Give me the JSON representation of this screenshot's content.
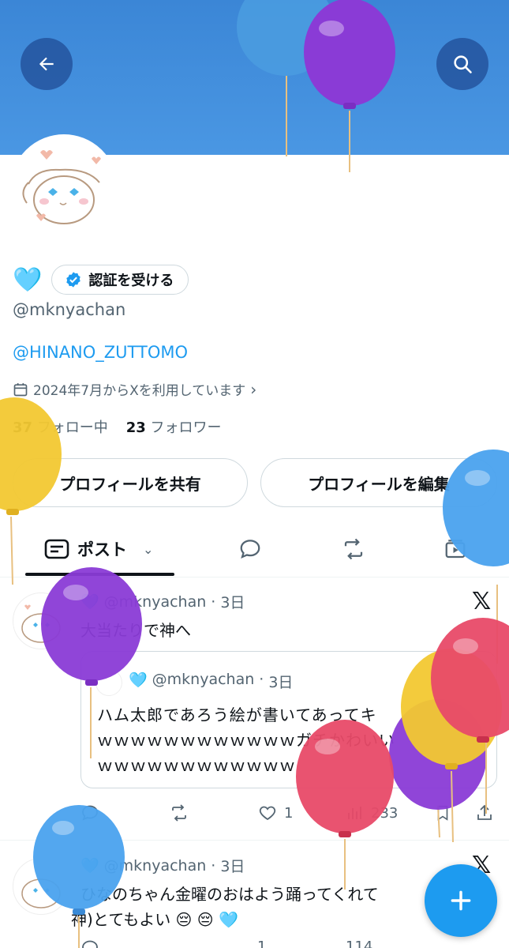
{
  "header": {
    "back_icon": "arrow-left-icon",
    "search_icon": "search-icon",
    "banner_color": "#3b86d6"
  },
  "profile": {
    "name_emoji": "🩵",
    "verify_label": "認証を受ける",
    "handle": "@mknyachan",
    "bio_link": "@HINANO_ZUTTOMO",
    "joined": "2024年7月からXを利用しています",
    "following_count": "37",
    "following_label": "フォロー中",
    "followers_count": "23",
    "followers_label": "フォロワー",
    "share_button": "プロフィールを共有",
    "edit_button": "プロフィールを編集"
  },
  "tabs": {
    "posts_label": "ポスト",
    "accent": "#1d9bf0"
  },
  "posts": [
    {
      "name_emoji": "🩵",
      "handle": "@mknyachan",
      "time": "3日",
      "text": "大当たりで神へ",
      "quote": {
        "name_emoji": "🩵",
        "handle": "@mknyachan",
        "time": "3日",
        "line1": "ハム太郎であろう絵が書いてあってキ",
        "line2": "ｗｗｗｗｗｗｗｗｗｗｗｗガチかわいい",
        "line3": "ｗｗｗｗｗｗｗｗｗｗｗｗ"
      },
      "likes": "1",
      "views": "233"
    },
    {
      "name_emoji": "🩵",
      "handle": "@mknyachan",
      "time": "3日",
      "line1": "ひなのちゃん金曜のおはよう踊ってくれて",
      "line2": "神)とてもよい 😔 😔 🩵",
      "likes": "1",
      "views": "114"
    }
  ]
}
